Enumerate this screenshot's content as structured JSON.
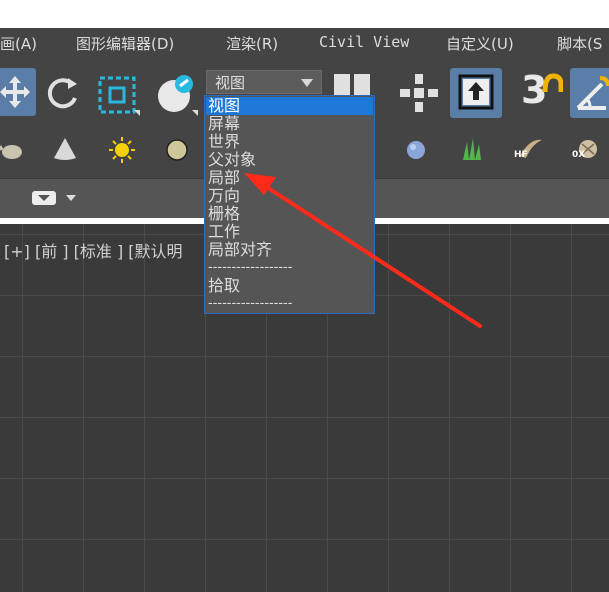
{
  "menubar": {
    "items": [
      {
        "label": "画(A)"
      },
      {
        "label": "图形编辑器(D)"
      },
      {
        "label": "渲染(R)"
      },
      {
        "label": "Civil View"
      },
      {
        "label": "自定义(U)"
      },
      {
        "label": "脚本(S"
      }
    ]
  },
  "toolbar": {
    "coordinate_dropdown": {
      "selected": "视图",
      "options": [
        {
          "label": "视图",
          "selected": true
        },
        {
          "label": "屏幕"
        },
        {
          "label": "世界"
        },
        {
          "label": "父对象"
        },
        {
          "label": "局部"
        },
        {
          "label": "万向"
        },
        {
          "label": "栅格"
        },
        {
          "label": "工作"
        },
        {
          "label": "局部对齐"
        },
        {
          "label": "------------------"
        },
        {
          "label": "拾取"
        },
        {
          "label": "------------------"
        }
      ]
    },
    "snap_label": "3"
  },
  "toolbar2": {
    "hf_label": "HF",
    "ox_label": "0X"
  },
  "viewport": {
    "label": "[+] [前 ] [标准 ] [默认明"
  },
  "annotation": {
    "arrow_color": "#ff2a1a"
  },
  "colors": {
    "ui_background": "#444444",
    "viewport_background": "#3a3a3a",
    "selection_blue": "#1e78d7",
    "active_button": "#5b7ea8"
  }
}
